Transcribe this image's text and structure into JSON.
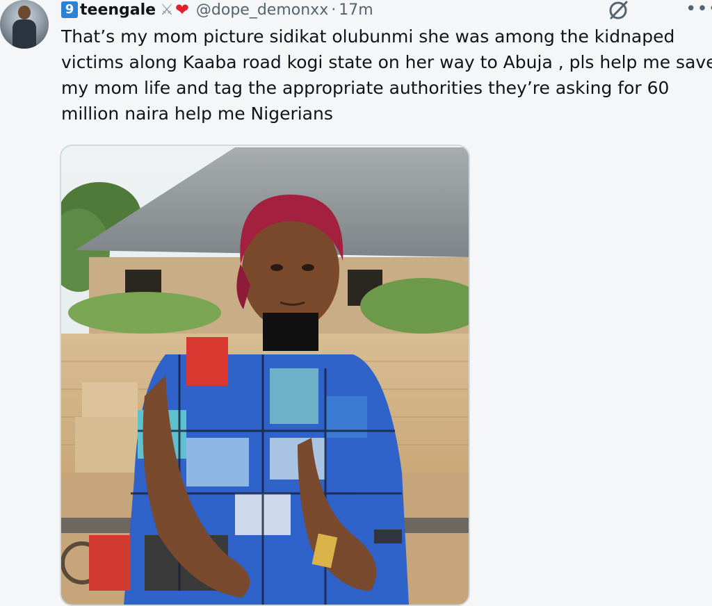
{
  "author": {
    "badge": "9",
    "display_name": "teengale",
    "handle": "@dope_demonxx",
    "separator": "·",
    "time": "17m"
  },
  "icons": {
    "avatar": "user-avatar",
    "swords": "crossed-swords-icon",
    "heart": "red-heart-icon",
    "grok": "grok-icon",
    "more": "more-options-icon"
  },
  "tweet": {
    "lines": [
      "That’s my mom picture sidikat olubunmi she was among the kidnaped",
      "victims along Kaaba road kogi state on her way to Abuja , pls help me save",
      "my mom life and tag the appropriate authorities they’re asking for 60",
      "million naira help me Nigerians"
    ]
  },
  "colors": {
    "background": "#f5f6f7",
    "badge": "#2b80d8",
    "heart": "#e0202b",
    "secondary_text": "#536471"
  }
}
